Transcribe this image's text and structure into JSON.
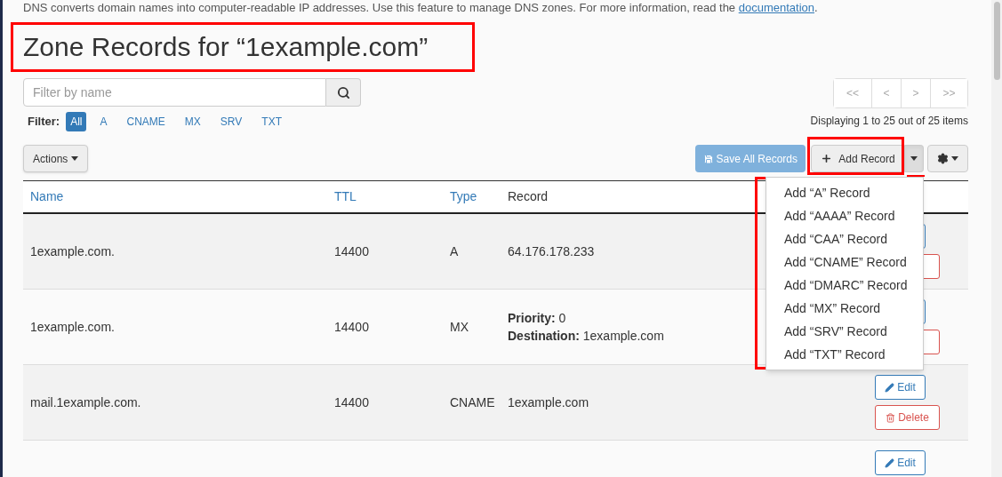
{
  "intro": {
    "text": "DNS converts domain names into computer-readable IP addresses. Use this feature to manage DNS zones. For more information, read the",
    "link": "documentation",
    "end": "."
  },
  "title": "Zone Records for “1example.com”",
  "filter_field": {
    "placeholder": "Filter by name"
  },
  "filter": {
    "label": "Filter:",
    "options": [
      {
        "label": "All",
        "selected": true
      },
      {
        "label": "A",
        "selected": false
      },
      {
        "label": "CNAME",
        "selected": false
      },
      {
        "label": "MX",
        "selected": false
      },
      {
        "label": "SRV",
        "selected": false
      },
      {
        "label": "TXT",
        "selected": false
      }
    ]
  },
  "pagination": {
    "buttons": [
      "<<",
      "<",
      ">",
      ">>"
    ],
    "summary": "Displaying 1 to 25 out of 25 items"
  },
  "toolbar": {
    "actions": "Actions",
    "save": {
      "label": "Save All Records",
      "disabled": true
    },
    "add": "Add Record"
  },
  "add_menu": {
    "expanded": true,
    "items": [
      "Add “A” Record",
      "Add “AAAA” Record",
      "Add “CAA” Record",
      "Add “CNAME” Record",
      "Add “DMARC” Record",
      "Add “MX” Record",
      "Add “SRV” Record",
      "Add “TXT” Record"
    ]
  },
  "table": {
    "columns": [
      {
        "label": "Name",
        "sortable": true
      },
      {
        "label": "TTL",
        "sortable": true
      },
      {
        "label": "Type",
        "sortable": true
      },
      {
        "label": "Record",
        "sortable": false
      }
    ],
    "rows": [
      {
        "name": "1example.com.",
        "ttl": "14400",
        "type": "A",
        "record": [
          "64.176.178.233"
        ],
        "covered_actions": true,
        "actions": []
      },
      {
        "name": "1example.com.",
        "ttl": "14400",
        "type": "MX",
        "record": [
          "**Priority:** 0",
          "**Destination:** 1example.com"
        ],
        "covered_actions": true,
        "actions": []
      },
      {
        "name": "mail.1example.com.",
        "ttl": "14400",
        "type": "CNAME",
        "record": [
          "1example.com"
        ],
        "covered_actions": false,
        "actions": [
          {
            "kind": "edit",
            "label": "Edit"
          },
          {
            "kind": "delete",
            "label": "Delete"
          }
        ]
      },
      {
        "covered_actions": false,
        "actions": [
          {
            "kind": "edit",
            "label": "Edit"
          }
        ]
      }
    ]
  }
}
